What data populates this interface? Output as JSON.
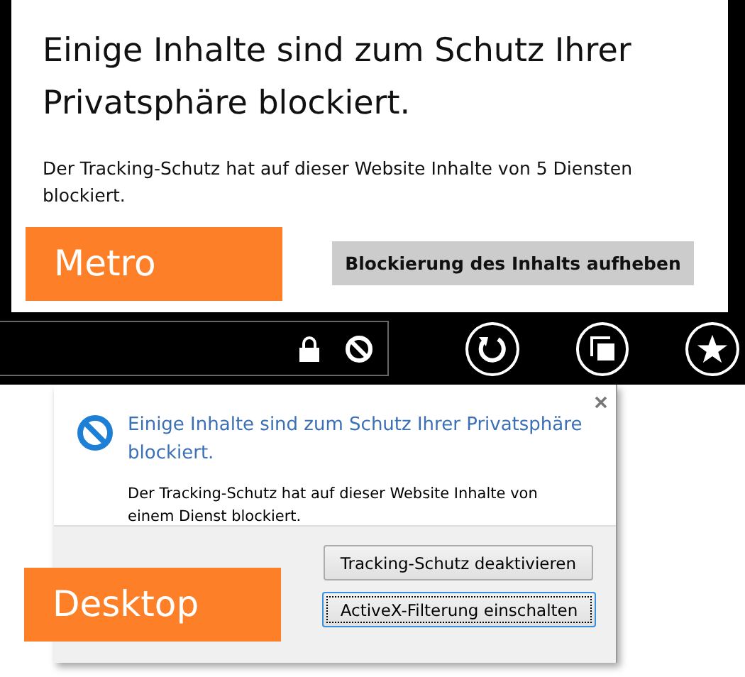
{
  "metro": {
    "title": "Einige Inhalte sind zum Schutz Ihrer Privatsphäre blockiert.",
    "message": "Der Tracking-Schutz hat auf dieser Website Inhalte von 5 Diensten blockiert.",
    "button": "Blockierung des Inhalts aufheben",
    "tag": "Metro"
  },
  "desktop": {
    "title": "Einige Inhalte sind zum Schutz Ihrer Privatsphäre blockiert.",
    "message": "Der Tracking-Schutz hat auf dieser Website Inhalte von einem Dienst blockiert.",
    "buttons": [
      {
        "label": "Tracking-Schutz deaktivieren",
        "focused": false
      },
      {
        "label": "ActiveX-Filterung einschalten",
        "focused": true
      }
    ],
    "tag": "Desktop"
  }
}
